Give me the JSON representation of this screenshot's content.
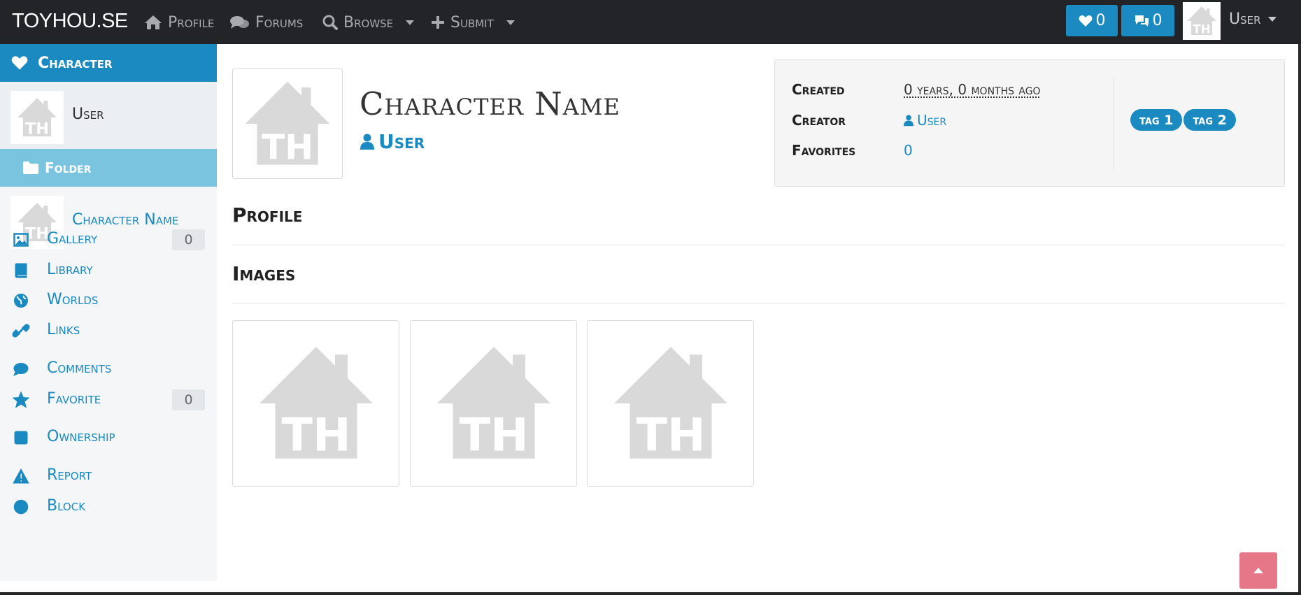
{
  "navbar": {
    "brand": "TOYHOU.SE",
    "items": [
      {
        "label": "Profile",
        "icon": "home-icon"
      },
      {
        "label": "Forums",
        "icon": "comments-icon"
      },
      {
        "label": "Browse",
        "icon": "search-icon"
      },
      {
        "label": "Submit",
        "icon": "plus-icon"
      }
    ],
    "favorites_count": "0",
    "messages_count": "0",
    "user_label": "User"
  },
  "sidebar": {
    "header": "Character",
    "user_label": "User",
    "folder_label": "Folder",
    "character_label": "Character Name",
    "links": [
      {
        "label": "Gallery",
        "icon": "image-icon",
        "badge": "0"
      },
      {
        "label": "Library",
        "icon": "book-icon"
      },
      {
        "label": "Worlds",
        "icon": "globe-icon"
      },
      {
        "label": "Links",
        "icon": "link-icon"
      },
      {
        "label": "Comments",
        "icon": "comment-icon"
      },
      {
        "label": "Favorite",
        "icon": "star-icon",
        "badge": "0"
      },
      {
        "label": "Ownership",
        "icon": "checkbox-icon"
      },
      {
        "label": "Report",
        "icon": "warning-icon"
      },
      {
        "label": "Block",
        "icon": "ban-icon"
      }
    ]
  },
  "character": {
    "name": "Character Name",
    "owner": "User"
  },
  "info": {
    "created_label": "Created",
    "created_value": "0 years, 0 months ago",
    "creator_label": "Creator",
    "creator_value": "User",
    "favorites_label": "Favorites",
    "favorites_value": "0",
    "tags": [
      "tag 1",
      "tag 2"
    ]
  },
  "sections": {
    "profile": "Profile",
    "images": "Images"
  },
  "colors": {
    "accent": "#1a8ac0",
    "navbar_bg": "#222427",
    "folder_bg": "#7bc4e0",
    "to_top_bg": "#e57788"
  }
}
